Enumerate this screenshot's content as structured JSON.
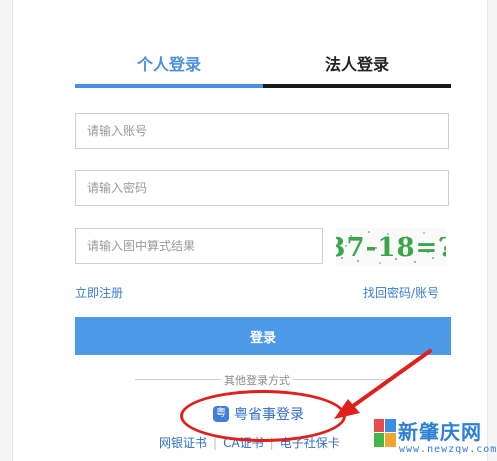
{
  "tabs": {
    "personal": "个人登录",
    "legal": "法人登录"
  },
  "form": {
    "account_placeholder": "请输入账号",
    "password_placeholder": "请输入密码",
    "captcha_placeholder": "请输入图中算式结果",
    "captcha_text": "37-18=?"
  },
  "links": {
    "register": "立即注册",
    "recover": "找回密码/账号"
  },
  "login_button": "登录",
  "other": {
    "label": "其他登录方式",
    "yss_icon": "粤",
    "yss_label": "粤省事登录",
    "methods": [
      "网银证书",
      "CA证书",
      "电子社保卡"
    ],
    "separator": "|"
  },
  "watermark": {
    "cn": "新肇庆网",
    "url": "www.newzqw.com"
  },
  "colors": {
    "accent": "#4a90e2",
    "button": "#4d9ae8",
    "link": "#3a7bd5",
    "highlight": "#e0201a"
  },
  "icons": {
    "yss": "yss-app-icon",
    "arrow": "red-arrow-annotation"
  }
}
